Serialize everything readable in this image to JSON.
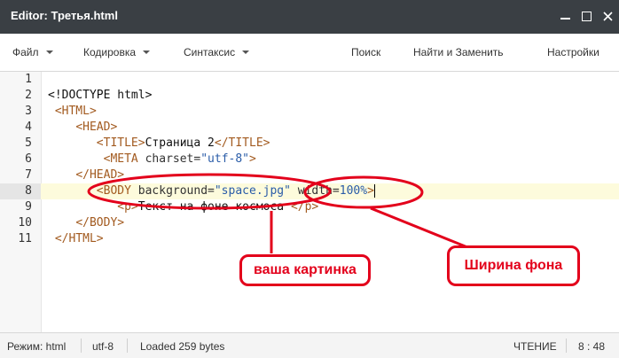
{
  "window": {
    "title": "Editor: Третья.html"
  },
  "menu": {
    "file": "Файл",
    "encoding": "Кодировка",
    "syntax": "Синтаксис",
    "search": "Поиск",
    "find_replace": "Найти и Заменить",
    "settings": "Настройки"
  },
  "editor": {
    "line_numbers": [
      "1",
      "2",
      "3",
      "4",
      "5",
      "6",
      "7",
      "8",
      "9",
      "10",
      "11"
    ],
    "active_line": 8,
    "lines": [
      [],
      [
        {
          "t": "<!DOCTYPE html>",
          "c": "txt"
        }
      ],
      [
        {
          "t": " ",
          "c": "txt"
        },
        {
          "t": "<HTML>",
          "c": "tag"
        }
      ],
      [
        {
          "t": "    ",
          "c": "txt"
        },
        {
          "t": "<HEAD>",
          "c": "tag"
        }
      ],
      [
        {
          "t": "       ",
          "c": "txt"
        },
        {
          "t": "<TITLE>",
          "c": "tag"
        },
        {
          "t": "Страница 2",
          "c": "txt"
        },
        {
          "t": "</TITLE>",
          "c": "tag"
        }
      ],
      [
        {
          "t": "        ",
          "c": "txt"
        },
        {
          "t": "<META",
          "c": "tag"
        },
        {
          "t": " charset=",
          "c": "att"
        },
        {
          "t": "\"utf-8\"",
          "c": "str"
        },
        {
          "t": ">",
          "c": "tag"
        }
      ],
      [
        {
          "t": "    ",
          "c": "txt"
        },
        {
          "t": "</HEAD>",
          "c": "tag"
        }
      ],
      [
        {
          "t": "       ",
          "c": "txt"
        },
        {
          "t": "<BODY",
          "c": "tag"
        },
        {
          "t": " background=",
          "c": "att"
        },
        {
          "t": "\"space.jpg\"",
          "c": "str"
        },
        {
          "t": " width=",
          "c": "att"
        },
        {
          "t": "100%",
          "c": "str"
        },
        {
          "t": ">",
          "c": "tag"
        }
      ],
      [
        {
          "t": "          ",
          "c": "txt"
        },
        {
          "t": "<p>",
          "c": "tag"
        },
        {
          "t": "Текст на фоне космоса ",
          "c": "txt"
        },
        {
          "t": "</p>",
          "c": "tag"
        }
      ],
      [
        {
          "t": "    ",
          "c": "txt"
        },
        {
          "t": "</BODY>",
          "c": "tag"
        }
      ],
      [
        {
          "t": " ",
          "c": "txt"
        },
        {
          "t": "</HTML>",
          "c": "tag"
        }
      ]
    ]
  },
  "annotations": {
    "picture_label": "ваша картинка",
    "width_label": "Ширина фона",
    "color": "#e3001b"
  },
  "status": {
    "mode": "Режим: html",
    "encoding": "utf-8",
    "loaded": "Loaded 259 bytes",
    "read_mode": "ЧТЕНИЕ",
    "position": "8 : 48"
  }
}
